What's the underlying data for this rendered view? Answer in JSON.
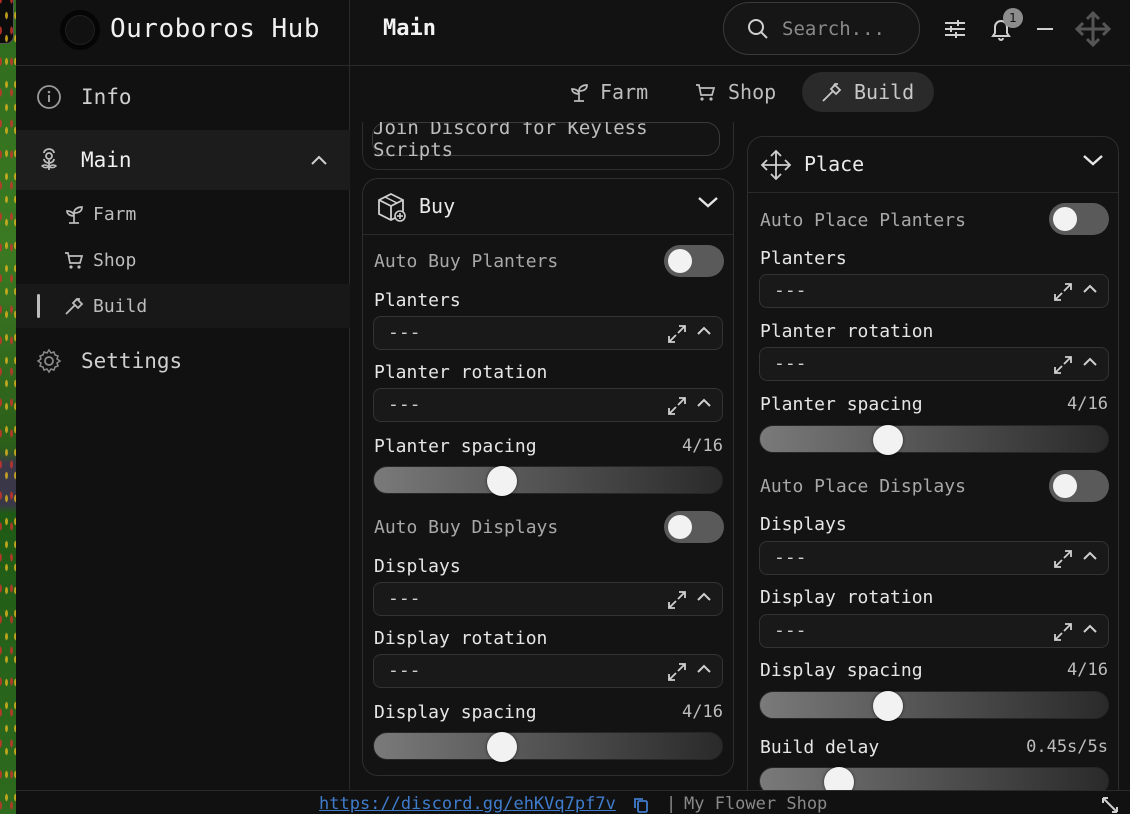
{
  "app": {
    "title": "Ouroboros Hub"
  },
  "header": {
    "title": "Main",
    "search_placeholder": "Search...",
    "notification_count": "1"
  },
  "sidebar": {
    "items": [
      {
        "label": "Info"
      },
      {
        "label": "Main"
      },
      {
        "label": "Settings"
      }
    ],
    "sub_items": [
      {
        "label": "Farm"
      },
      {
        "label": "Shop"
      },
      {
        "label": "Build"
      }
    ]
  },
  "tabs": [
    {
      "label": "Farm"
    },
    {
      "label": "Shop"
    },
    {
      "label": "Build"
    }
  ],
  "discord_button": "Join Discord for Keyless Scripts",
  "buy": {
    "title": "Buy",
    "auto_planters": "Auto Buy Planters",
    "planters": {
      "label": "Planters",
      "value": "---"
    },
    "planter_rotation": {
      "label": "Planter rotation",
      "value": "---"
    },
    "planter_spacing": {
      "label": "Planter spacing",
      "value": "4/16",
      "level": 0.25
    },
    "auto_displays": "Auto Buy Displays",
    "displays": {
      "label": "Displays",
      "value": "---"
    },
    "display_rotation": {
      "label": "Display rotation",
      "value": "---"
    },
    "display_spacing": {
      "label": "Display spacing",
      "value": "4/16",
      "level": 0.25
    }
  },
  "place": {
    "title": "Place",
    "auto_planters": "Auto Place Planters",
    "planters": {
      "label": "Planters",
      "value": "---"
    },
    "planter_rotation": {
      "label": "Planter rotation",
      "value": "---"
    },
    "planter_spacing": {
      "label": "Planter spacing",
      "value": "4/16",
      "level": 0.25
    },
    "auto_displays": "Auto Place Displays",
    "displays": {
      "label": "Displays",
      "value": "---"
    },
    "display_rotation": {
      "label": "Display rotation",
      "value": "---"
    },
    "display_spacing": {
      "label": "Display spacing",
      "value": "4/16",
      "level": 0.25
    },
    "build_delay": {
      "label": "Build delay",
      "value": "0.45s/5s",
      "level": 0.09
    }
  },
  "footer": {
    "link": "https://discord.gg/ehKVq7pf7v",
    "separator": "|",
    "game": "My Flower Shop"
  },
  "colors": {
    "background": "#121212",
    "panel": "#131313",
    "link": "#3f7ccc",
    "toggle_off": "#5a5a5a"
  }
}
